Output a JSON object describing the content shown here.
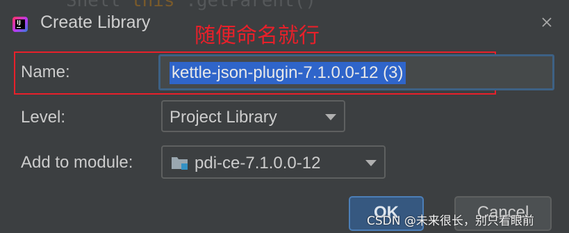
{
  "window": {
    "title": "Create Library",
    "background_code_fragment": "Shell        ",
    "background_code_orange": "this",
    "background_code_tail": "   .getParent()"
  },
  "annotation": {
    "text": "随便命名就行",
    "color": "#e8202a"
  },
  "form": {
    "name": {
      "label": "Name:",
      "value": "kettle-json-plugin-7.1.0.0-12 (3)",
      "selected": true
    },
    "level": {
      "label": "Level:",
      "selected_value": "Project Library"
    },
    "module": {
      "label": "Add to module:",
      "selected_value": "pdi-ce-7.1.0.0-12",
      "icon": "module-folder-icon"
    }
  },
  "buttons": {
    "ok_label": "OK",
    "cancel_label": "Cancel"
  },
  "watermark": {
    "text": "CSDN @未来很长，别只看眼前"
  },
  "colors": {
    "background": "#3c3f41",
    "selection": "#2f65ca",
    "focus_border": "#3d6185",
    "ok_button": "#365880"
  }
}
